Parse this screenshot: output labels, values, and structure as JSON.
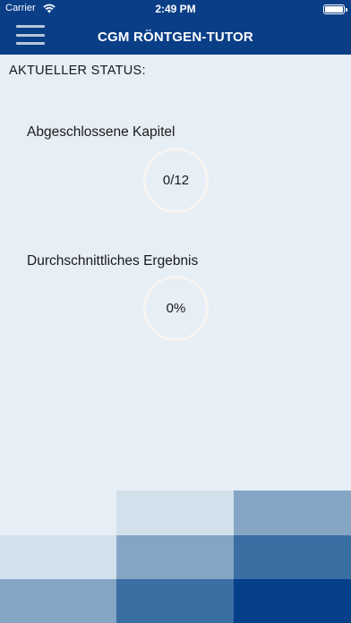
{
  "statusbar": {
    "carrier": "Carrier",
    "time": "2:49 PM",
    "wifi_icon": "wifi-icon",
    "battery_icon": "battery-icon"
  },
  "header": {
    "title": "CGM RÖNTGEN-TUTOR",
    "menu_icon": "hamburger-menu-icon",
    "background_color": "#0a3f88"
  },
  "main": {
    "heading": "AKTUELLER STATUS:",
    "stats": [
      {
        "label": "Abgeschlossene Kapitel",
        "value": "0/12"
      },
      {
        "label": "Durchschnittliches Ergebnis",
        "value": "0%"
      }
    ]
  },
  "mosaic": {
    "colors": {
      "lightest": "#e6eef6",
      "light": "#d2e0ec",
      "medium": "#85a5c5",
      "dark": "#3b6ea3",
      "darkest": "#053f8a"
    }
  }
}
